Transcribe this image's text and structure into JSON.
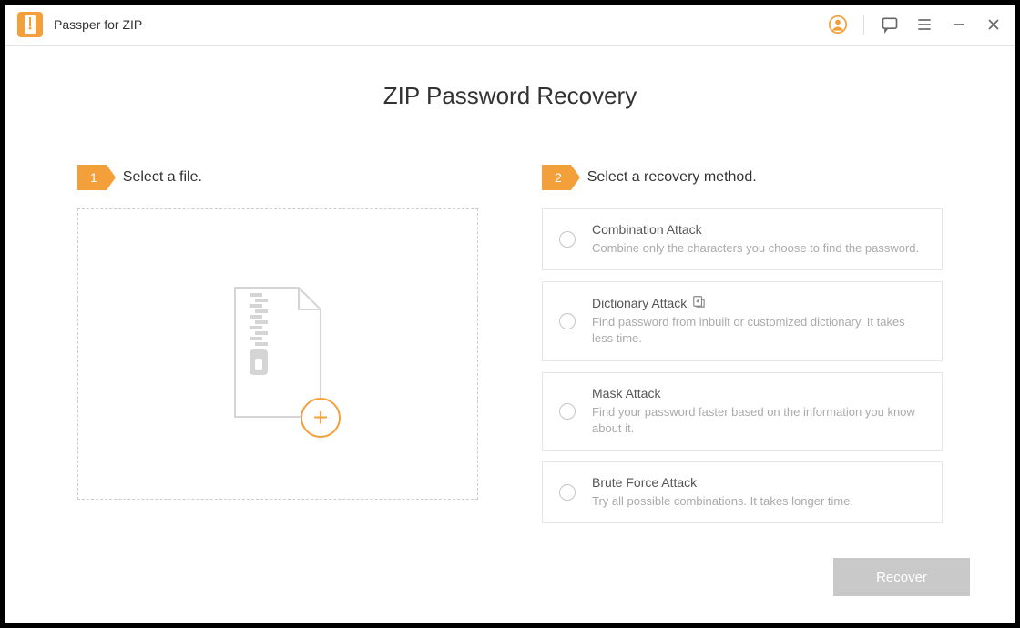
{
  "app": {
    "title": "Passper for ZIP"
  },
  "page": {
    "title": "ZIP Password Recovery"
  },
  "step1": {
    "num": "1",
    "label": "Select a file."
  },
  "step2": {
    "num": "2",
    "label": "Select a recovery method."
  },
  "methods": [
    {
      "title": "Combination Attack",
      "desc": "Combine only the characters you choose to find the password.",
      "import": false
    },
    {
      "title": "Dictionary Attack",
      "desc": "Find password from inbuilt or customized dictionary. It takes less time.",
      "import": true
    },
    {
      "title": "Mask Attack",
      "desc": "Find your password faster based on the information you know about it.",
      "import": false
    },
    {
      "title": "Brute Force Attack",
      "desc": "Try all possible combinations. It takes longer time.",
      "import": false
    }
  ],
  "recover": {
    "label": "Recover"
  }
}
